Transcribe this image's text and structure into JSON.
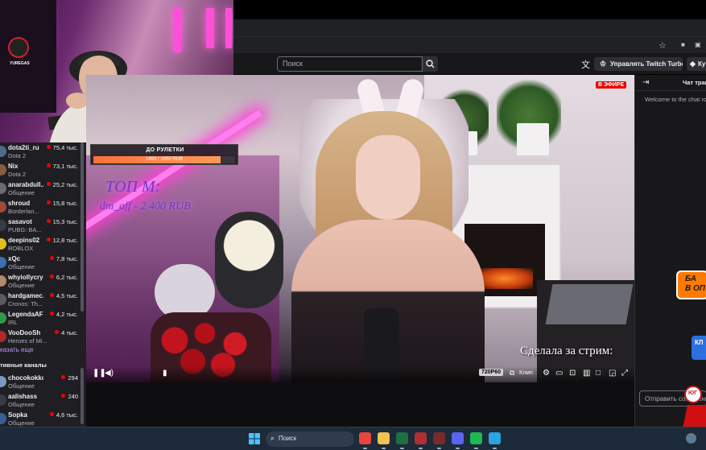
{
  "browser": {
    "toolbar_icons": [
      "star-icon",
      "extension-icon",
      "extension-icon"
    ]
  },
  "twitch_nav": {
    "search_placeholder": "Поиск",
    "turbo_label": "Управлять Twitch Turbo",
    "get_label": "Ку"
  },
  "webcam": {
    "logo_text": "YUREGAS"
  },
  "sidebar": {
    "channels": [
      {
        "name": "dota2ti_ru",
        "game": "Dota 2",
        "viewers": "75,4 тыс.",
        "color": "#4c6b8a"
      },
      {
        "name": "Nix",
        "game": "Dota 2",
        "viewers": "73,1 тыс.",
        "color": "#8a5c3c"
      },
      {
        "name": "anarabdull...",
        "game": "Общение",
        "viewers": "25,2 тыс.",
        "color": "#6b6b74"
      },
      {
        "name": "shroud",
        "game": "Borderlan...",
        "viewers": "15,8 тыс.",
        "color": "#a04a3a"
      },
      {
        "name": "sasavot",
        "game": "PUBG: BA...",
        "viewers": "15,3 тыс.",
        "color": "#3a3a44"
      },
      {
        "name": "deepins02",
        "game": "ROBLOX",
        "viewers": "12,8 тыс.",
        "color": "#e0c020"
      },
      {
        "name": "xQc",
        "game": "Общение",
        "viewers": "7,8 тыс.",
        "color": "#3f6db0"
      },
      {
        "name": "whyiollycry",
        "game": "Общение",
        "viewers": "6,2 тыс.",
        "color": "#b08a6a"
      },
      {
        "name": "hardgamec...",
        "game": "Cronos: Th...",
        "viewers": "4,5 тыс.",
        "color": "#5a5a60"
      },
      {
        "name": "LegendaAFK",
        "game": "IRL",
        "viewers": "4,2 тыс.",
        "color": "#2f9a4a"
      },
      {
        "name": "VooDooSh",
        "game": "Heroes of Mi...",
        "viewers": "4 тыс.",
        "color": "#b02a2a"
      }
    ],
    "show_more": "казать еще",
    "active_header": "тивные каналы",
    "active_channels": [
      {
        "name": "chocokokko_",
        "game": "Общение",
        "viewers": "294",
        "color": "#7a9ac4"
      },
      {
        "name": "aalishass",
        "game": "Общение",
        "viewers": "240",
        "color": "#3a3a44"
      },
      {
        "name": "Sopka",
        "game": "Общение",
        "viewers": "4,6 тыс.",
        "color": "#3b5e9a"
      }
    ]
  },
  "player": {
    "donation_title": "ДО РУЛЕТКИ",
    "donation_progress_text": "1483 / 1650 RUB",
    "donation_progress": 0.8988,
    "top_label": "ТОП М:",
    "top_donor": "dm_aff - 2 400 RUB",
    "live_badge": "В ЭФИРЕ",
    "caption": "Сделала за стрим:",
    "quality": "720P60",
    "clip_label": "Клип"
  },
  "chat": {
    "title": "Чат трансляции",
    "welcome": "Welcome to the chat room!",
    "ad_text_line1": "БА",
    "ad_text_line2": "В ОП",
    "ad_logo_text": "КЛ",
    "input_placeholder": "Отправить сообщение",
    "red_logo_text": "ЮГ"
  },
  "taskbar": {
    "search_placeholder": "Поиск",
    "apps": [
      {
        "name": "chrome-icon",
        "color": "#e8453c"
      },
      {
        "name": "file-explorer-icon",
        "color": "#f2c14e"
      },
      {
        "name": "excel-icon",
        "color": "#1d6f42"
      },
      {
        "name": "app-icon",
        "color": "#b03030"
      },
      {
        "name": "app-icon",
        "color": "#7a2a2a"
      },
      {
        "name": "discord-icon",
        "color": "#5865f2"
      },
      {
        "name": "spotify-icon",
        "color": "#1db954"
      },
      {
        "name": "telegram-icon",
        "color": "#2aa3df"
      }
    ]
  }
}
